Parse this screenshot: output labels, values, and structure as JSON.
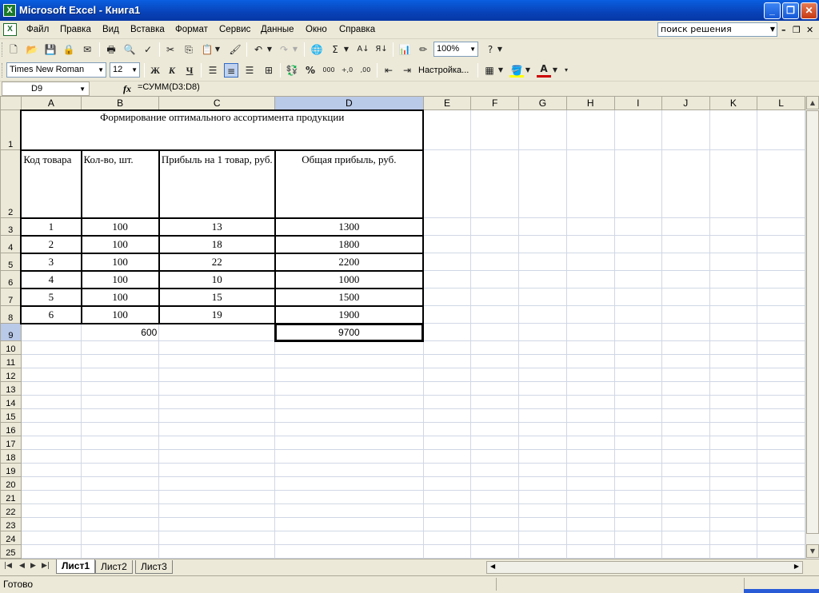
{
  "window": {
    "title": "Microsoft Excel - Книга1",
    "app_icon": "excel-icon",
    "controls": {
      "minimize": "_",
      "restore": "❐",
      "close": "✕"
    }
  },
  "menu": {
    "items": [
      "Файл",
      "Правка",
      "Вид",
      "Вставка",
      "Формат",
      "Сервис",
      "Данные",
      "Окно",
      "Справка"
    ],
    "help_box": "поиск решения"
  },
  "toolbar_standard": {
    "zoom": "100%"
  },
  "toolbar_format": {
    "font": "Times New Roman",
    "size": "12",
    "bold": "Ж",
    "italic": "К",
    "underline": "Ч",
    "setup": "Настройка..."
  },
  "formula_bar": {
    "cell_ref": "D9",
    "fx": "fx",
    "formula": "=СУММ(D3:D8)"
  },
  "sheet": {
    "columns": [
      "A",
      "B",
      "C",
      "D",
      "E",
      "F",
      "G",
      "H",
      "I",
      "J",
      "K",
      "L"
    ],
    "title": "Формирование оптимального ассортимента продукции",
    "headers": [
      "Код товара",
      "Кол-во, шт.",
      "Прибыль на 1 товар, руб.",
      "Общая прибыль,  руб."
    ],
    "rows": [
      [
        "1",
        "100",
        "13",
        "1300"
      ],
      [
        "2",
        "100",
        "18",
        "1800"
      ],
      [
        "3",
        "100",
        "22",
        "2200"
      ],
      [
        "4",
        "100",
        "10",
        "1000"
      ],
      [
        "5",
        "100",
        "15",
        "1500"
      ],
      [
        "6",
        "100",
        "19",
        "1900"
      ]
    ],
    "total_qty": "600",
    "total_profit": "9700",
    "row_numbers": [
      "1",
      "2",
      "3",
      "4",
      "5",
      "6",
      "7",
      "8",
      "9",
      "10",
      "11",
      "12",
      "13",
      "14",
      "15",
      "16",
      "17",
      "18",
      "19",
      "20",
      "21",
      "22",
      "23",
      "24",
      "25"
    ]
  },
  "tabs": [
    "Лист1",
    "Лист2",
    "Лист3"
  ],
  "status": "Готово"
}
